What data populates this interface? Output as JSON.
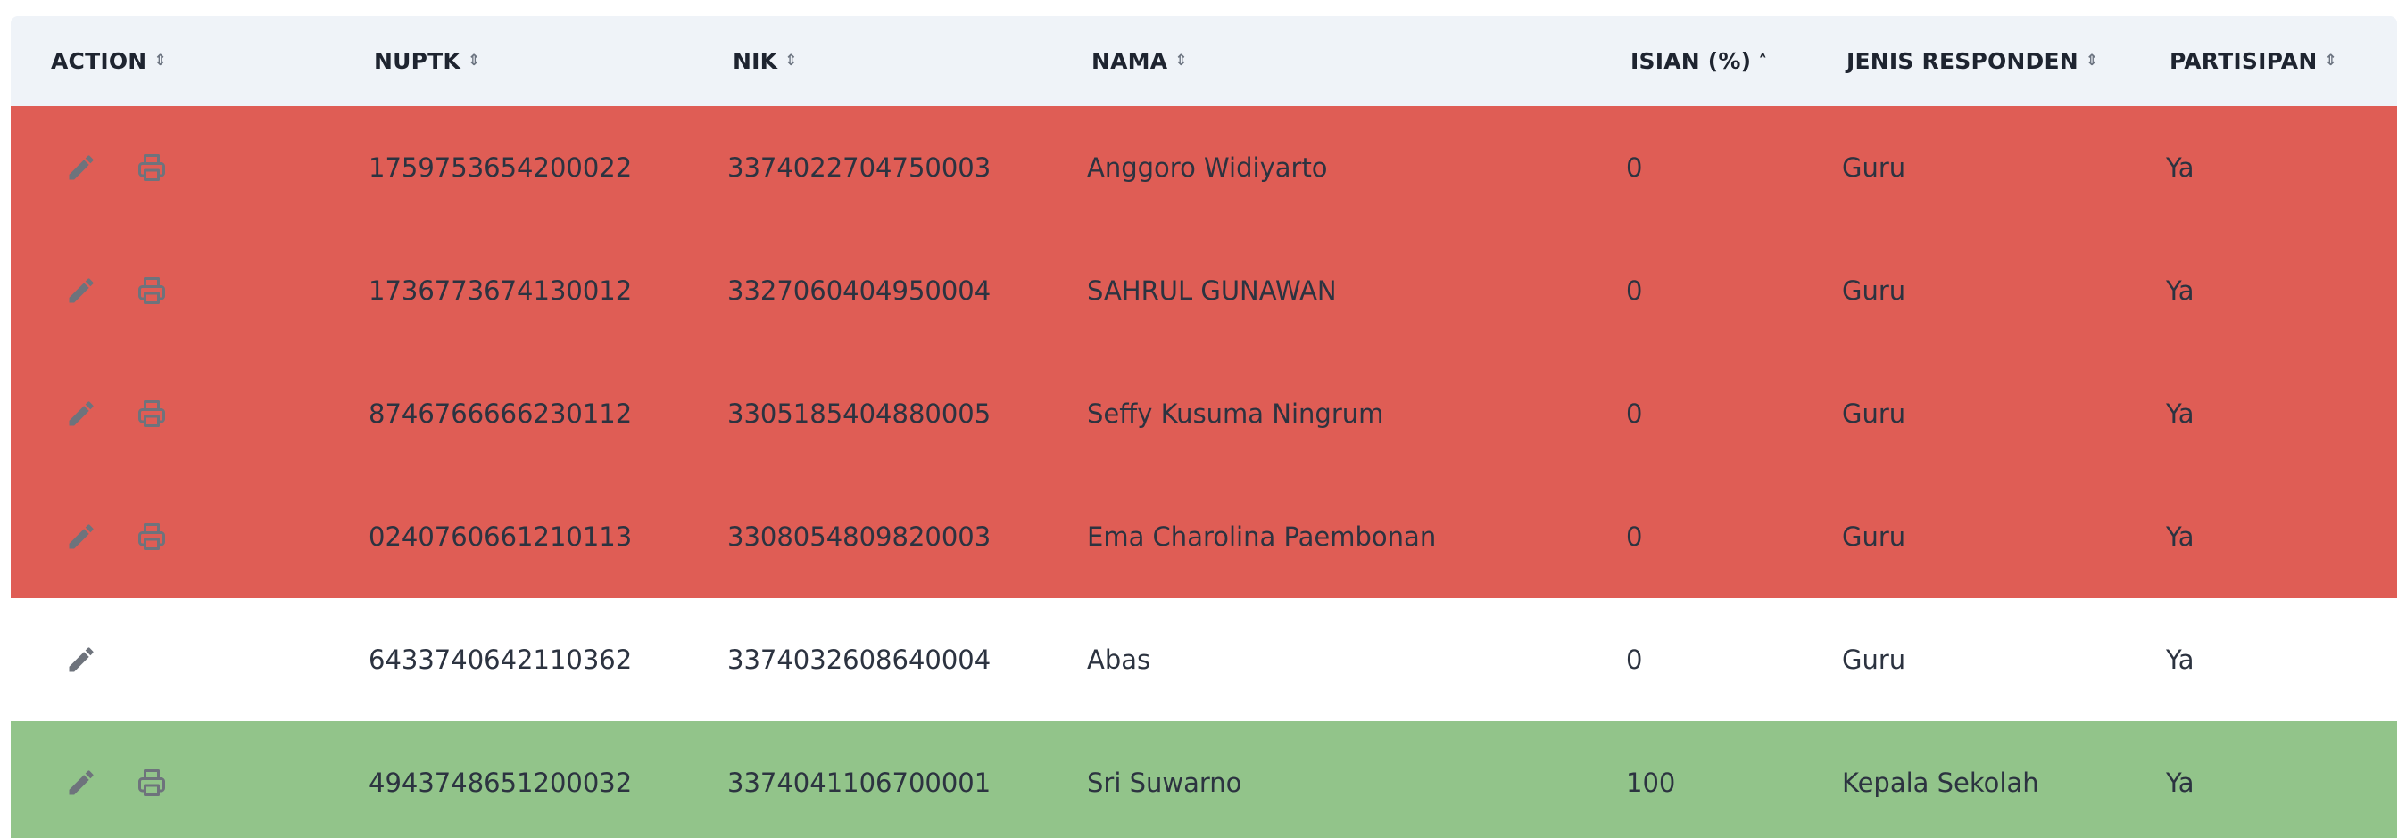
{
  "colors": {
    "header_bg": "#eff3f8",
    "row_red": "#df5d55",
    "row_white": "#ffffff",
    "row_green": "#92c48a",
    "icon_gray": "#6e737c"
  },
  "headers": {
    "action": "ACTION",
    "nuptk": "NUPTK",
    "nik": "NIK",
    "nama": "NAMA",
    "isian": "ISIAN (%)",
    "jenis": "JENIS RESPONDEN",
    "partisipan": "PARTISIPAN"
  },
  "sort": {
    "active_column": "isian",
    "direction": "ascending"
  },
  "rows": [
    {
      "status": "red",
      "has_print": true,
      "nuptk": "1759753654200022",
      "nik": "3374022704750003",
      "nama": "Anggoro Widiyarto",
      "isian": "0",
      "jenis": "Guru",
      "partisipan": "Ya"
    },
    {
      "status": "red",
      "has_print": true,
      "nuptk": "1736773674130012",
      "nik": "3327060404950004",
      "nama": "SAHRUL GUNAWAN",
      "isian": "0",
      "jenis": "Guru",
      "partisipan": "Ya"
    },
    {
      "status": "red",
      "has_print": true,
      "nuptk": "8746766666230112",
      "nik": "3305185404880005",
      "nama": "Seffy Kusuma Ningrum",
      "isian": "0",
      "jenis": "Guru",
      "partisipan": "Ya"
    },
    {
      "status": "red",
      "has_print": true,
      "nuptk": "0240760661210113",
      "nik": "3308054809820003",
      "nama": "Ema Charolina Paembonan",
      "isian": "0",
      "jenis": "Guru",
      "partisipan": "Ya"
    },
    {
      "status": "white",
      "has_print": false,
      "nuptk": "6433740642110362",
      "nik": "3374032608640004",
      "nama": "Abas",
      "isian": "0",
      "jenis": "Guru",
      "partisipan": "Ya"
    },
    {
      "status": "green",
      "has_print": true,
      "nuptk": "4943748651200032",
      "nik": "3374041106700001",
      "nama": "Sri Suwarno",
      "isian": "100",
      "jenis": "Kepala Sekolah",
      "partisipan": "Ya"
    }
  ]
}
